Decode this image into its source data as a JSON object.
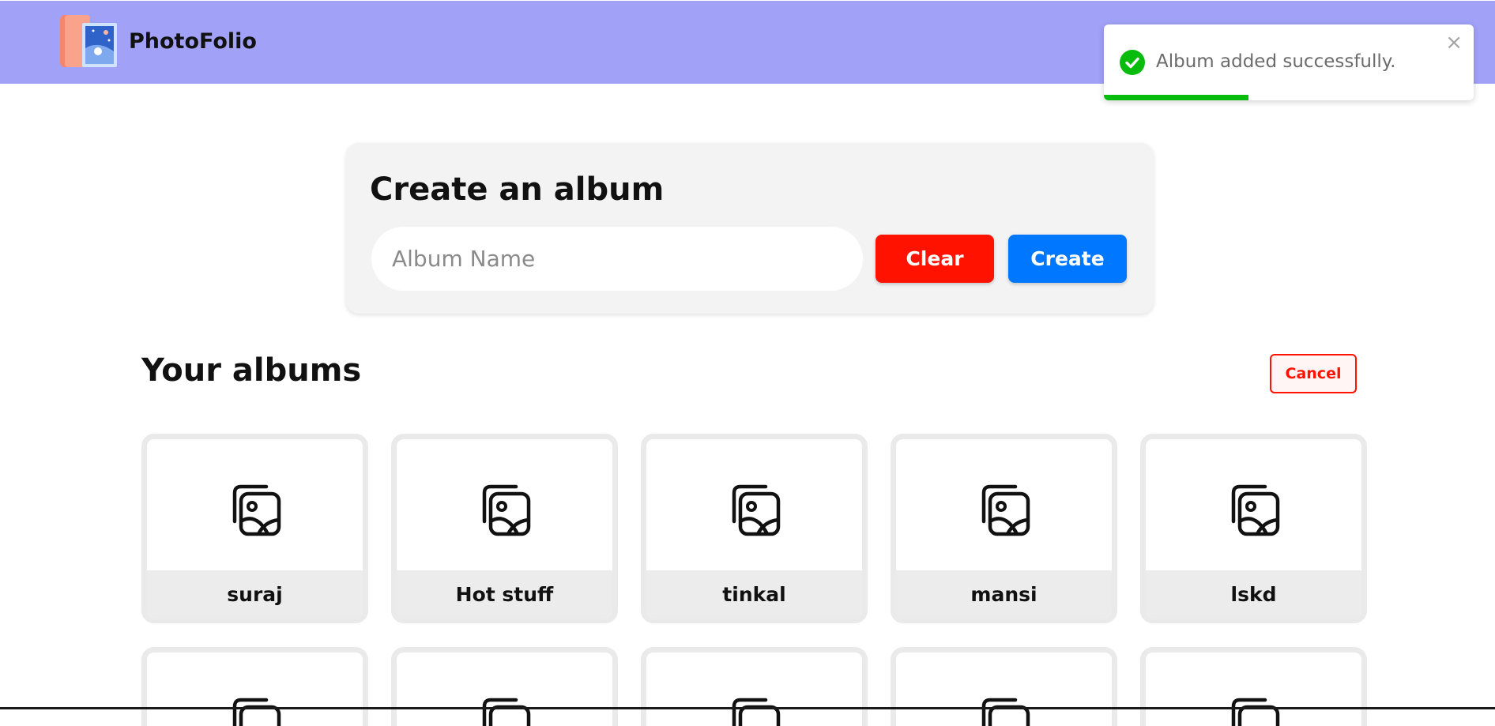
{
  "app": {
    "title": "PhotoFolio",
    "logo_icon": "photo-album-icon"
  },
  "toast": {
    "message": "Album added successfully.",
    "icon": "check-circle-icon",
    "close_symbol": "×",
    "progress": 0.39,
    "color": "#07bc0c"
  },
  "create_form": {
    "title": "Create an album",
    "input_placeholder": "Album Name",
    "input_value": "",
    "clear_label": "Clear",
    "create_label": "Create"
  },
  "albums_section": {
    "heading": "Your albums",
    "cancel_label": "Cancel",
    "albums": [
      {
        "name": "suraj",
        "icon": "image-gallery-icon"
      },
      {
        "name": "Hot stuff",
        "icon": "image-gallery-icon"
      },
      {
        "name": "tinkal",
        "icon": "image-gallery-icon"
      },
      {
        "name": "mansi",
        "icon": "image-gallery-icon"
      },
      {
        "name": "lskd",
        "icon": "image-gallery-icon"
      }
    ]
  },
  "colors": {
    "navbar": "#a0a1f7",
    "clear_button": "#ff1300",
    "create_button": "#0077ff",
    "cancel_button": "#ff1300"
  }
}
